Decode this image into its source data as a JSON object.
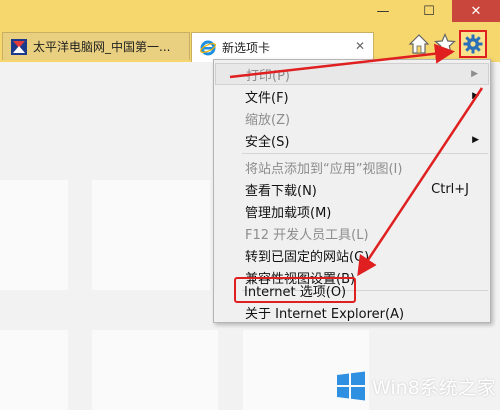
{
  "titlebar": {
    "minimize_glyph": "—",
    "maximize_glyph": "☐",
    "close_glyph": "✕",
    "color": "#f5d76e"
  },
  "tabs": [
    {
      "label": "太平洋电脑网_中国第一...",
      "active": false
    },
    {
      "label": "新选项卡",
      "active": true,
      "close_glyph": "✕"
    }
  ],
  "toolbar": {
    "home": "home-icon",
    "favorites": "star-icon",
    "tools": "gear-icon"
  },
  "menu": {
    "items": [
      {
        "label": "打印(P)",
        "disabled": true,
        "submenu": true
      },
      {
        "label": "文件(F)",
        "disabled": false,
        "submenu": true
      },
      {
        "label": "缩放(Z)",
        "disabled": true,
        "submenu": false
      },
      {
        "label": "安全(S)",
        "disabled": false,
        "submenu": true
      },
      {
        "label": "将站点添加到“应用”视图(I)",
        "disabled": true,
        "submenu": false
      },
      {
        "label": "查看下载(N)",
        "disabled": false,
        "shortcut": "Ctrl+J"
      },
      {
        "label": "管理加载项(M)",
        "disabled": false
      },
      {
        "label": "F12 开发人员工具(L)",
        "disabled": true
      },
      {
        "label": "转到已固定的网站(G)",
        "disabled": false
      },
      {
        "label": "兼容性视图设置(B)",
        "disabled": false
      },
      {
        "label": "Internet 选项(O)",
        "disabled": false
      },
      {
        "label": "关于 Internet Explorer(A)",
        "disabled": false
      }
    ],
    "submenu_arrow": "▶"
  },
  "highlight_color": "#e02020",
  "watermark": {
    "text": "Win8系统之家"
  }
}
